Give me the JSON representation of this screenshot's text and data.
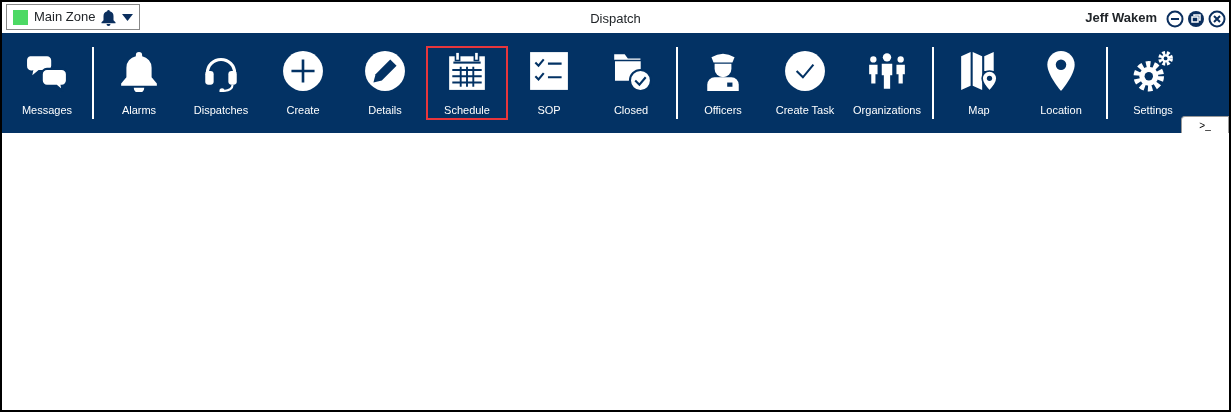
{
  "zone_selector": {
    "color": "#4cd964",
    "label": "Main Zone"
  },
  "window": {
    "title": "Dispatch",
    "user": "Jeff Wakem"
  },
  "toolbar": [
    {
      "kind": "button",
      "label": "Messages",
      "highlighted": false
    },
    {
      "kind": "separator"
    },
    {
      "kind": "button",
      "label": "Alarms",
      "highlighted": false
    },
    {
      "kind": "button",
      "label": "Dispatches",
      "highlighted": false
    },
    {
      "kind": "button",
      "label": "Create",
      "highlighted": false
    },
    {
      "kind": "button",
      "label": "Details",
      "highlighted": false
    },
    {
      "kind": "button",
      "label": "Schedule",
      "highlighted": true
    },
    {
      "kind": "button",
      "label": "SOP",
      "highlighted": false
    },
    {
      "kind": "button",
      "label": "Closed",
      "highlighted": false
    },
    {
      "kind": "separator"
    },
    {
      "kind": "button",
      "label": "Officers",
      "highlighted": false
    },
    {
      "kind": "button",
      "label": "Create Task",
      "highlighted": false
    },
    {
      "kind": "button",
      "label": "Organizations",
      "highlighted": false
    },
    {
      "kind": "separator"
    },
    {
      "kind": "button",
      "label": "Map",
      "highlighted": false
    },
    {
      "kind": "button",
      "label": "Location",
      "highlighted": false
    },
    {
      "kind": "separator"
    },
    {
      "kind": "button",
      "label": "Settings",
      "highlighted": false
    }
  ],
  "console_tab": {
    "label": ">_"
  }
}
